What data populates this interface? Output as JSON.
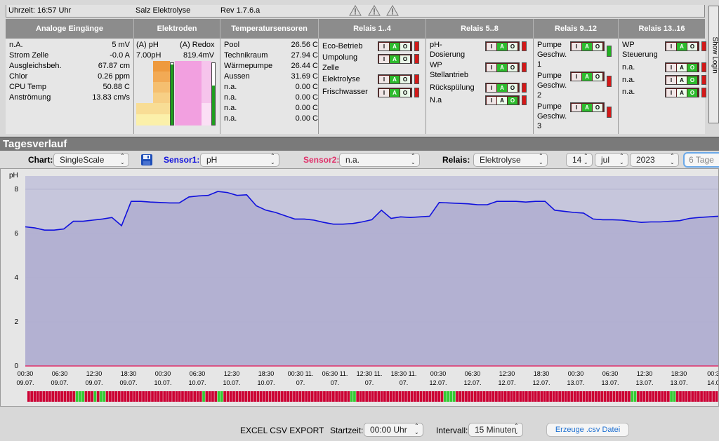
{
  "topbar": {
    "time": "Uhrzeit: 16:57 Uhr",
    "title": "Salz Elektrolyse",
    "rev": "Rev 1.7.6.a"
  },
  "header": {
    "analog": "Analoge Eingänge",
    "elektroden": "Elektroden",
    "temp": "Temperatursensoren",
    "r1": "Relais 1..4",
    "r2": "Relais 5..8",
    "r3": "Relais 9..12",
    "r4": "Relais 13..16"
  },
  "analog": [
    {
      "label": "n.A.",
      "value": "5 mV"
    },
    {
      "label": "Strom Zelle",
      "value": "-0.0 A"
    },
    {
      "label": "Ausgleichsbeh.",
      "value": "67.87 cm"
    },
    {
      "label": "Chlor",
      "value": "0.26 ppm"
    },
    {
      "label": "CPU Temp",
      "value": "50.88 C"
    },
    {
      "label": "Anströmung",
      "value": "13.83 cm/s"
    }
  ],
  "elektroden": {
    "ph_label": "(A) pH",
    "ph_value": "7.00pH",
    "redox_label": "(A) Redox",
    "redox_value": "819.4mV"
  },
  "temps": [
    {
      "label": "Pool",
      "value": "26.56 C"
    },
    {
      "label": "Technikraum",
      "value": "27.94 C"
    },
    {
      "label": "Wärmepumpe",
      "value": "26.44 C"
    },
    {
      "label": "Aussen",
      "value": "31.69 C"
    },
    {
      "label": "n.a.",
      "value": "0.00 C"
    },
    {
      "label": "n.a.",
      "value": "0.00 C"
    },
    {
      "label": "n.a.",
      "value": "0.00 C"
    },
    {
      "label": "n.a.",
      "value": "0.00 C"
    }
  ],
  "relays1": [
    "Eco-Betrieb",
    "Umpolung",
    "Zelle",
    "Elektrolyse",
    "Frischwasser"
  ],
  "relays2": [
    "pH-",
    "Dosierung",
    "WP",
    "Stellantrieb",
    "Rückspülung",
    "N.a"
  ],
  "relays3": [
    "Pumpe",
    "Geschw.",
    "1",
    "Pumpe",
    "Geschw.",
    "2",
    "Pumpe",
    "Geschw.",
    "3"
  ],
  "relays4": [
    "WP",
    "Steuerung",
    "n.a.",
    "n.a.",
    "n.a."
  ],
  "relay_btn": {
    "i": "I",
    "a": "A",
    "o": "O"
  },
  "login": "Show Login",
  "tagesverlauf": "Tagesverlauf",
  "controls": {
    "chart_label": "Chart:",
    "chart_value": "SingleScale",
    "sensor1_label": "Sensor1:",
    "sensor1_value": "pH",
    "sensor2_label": "Sensor2:",
    "sensor2_value": "n.a.",
    "relais_label": "Relais:",
    "relais_value": "Elektrolyse",
    "day": "14",
    "month": "jul",
    "year": "2023",
    "range": "6 Tage"
  },
  "colors": {
    "sensor1": "#1010dd",
    "sensor2": "#e0306a",
    "area": "#b0aed0",
    "on": "#33cc33",
    "off": "#cc0033"
  },
  "chart_data": {
    "type": "area",
    "ylabel": "pH",
    "ylim": [
      0,
      8.6
    ],
    "yticks": [
      "8",
      "6",
      "4",
      "2",
      "0"
    ],
    "yticks_values": [
      8,
      6,
      4,
      2,
      0
    ],
    "xticks": [
      [
        "00:30",
        "09.07."
      ],
      [
        "06:30",
        "09.07."
      ],
      [
        "12:30",
        "09.07."
      ],
      [
        "18:30",
        "09.07."
      ],
      [
        "00:30",
        "10.07."
      ],
      [
        "06:30",
        "10.07."
      ],
      [
        "12:30",
        "10.07."
      ],
      [
        "18:30",
        "10.07."
      ],
      [
        "00:30 11.",
        "07."
      ],
      [
        "06:30 11.",
        "07."
      ],
      [
        "12:30 11.",
        "07."
      ],
      [
        "18:30 11.",
        "07."
      ],
      [
        "00:30",
        "12.07."
      ],
      [
        "06:30",
        "12.07."
      ],
      [
        "12:30",
        "12.07."
      ],
      [
        "18:30",
        "12.07."
      ],
      [
        "00:30",
        "13.07."
      ],
      [
        "06:30",
        "13.07."
      ],
      [
        "12:30",
        "13.07."
      ],
      [
        "18:30",
        "13.07."
      ],
      [
        "00:3",
        "14.0"
      ]
    ],
    "series": [
      {
        "values": [
          6.3,
          6.25,
          6.15,
          6.15,
          6.2,
          6.55,
          6.55,
          6.6,
          6.65,
          6.72,
          6.35,
          7.45,
          7.45,
          7.42,
          7.4,
          7.38,
          7.38,
          7.65,
          7.7,
          7.72,
          7.9,
          7.85,
          7.72,
          7.75,
          7.25,
          7.05,
          6.95,
          6.8,
          6.65,
          6.65,
          6.6,
          6.5,
          6.42,
          6.42,
          6.45,
          6.52,
          6.62,
          7.05,
          6.68,
          6.75,
          6.72,
          6.75,
          6.78,
          7.4,
          7.38,
          7.36,
          7.34,
          7.3,
          7.3,
          7.45,
          7.45,
          7.45,
          7.42,
          7.45,
          7.45,
          7.05,
          7.0,
          6.95,
          6.92,
          6.65,
          6.62,
          6.62,
          6.6,
          6.55,
          6.5,
          6.52,
          6.52,
          6.55,
          6.58,
          6.68,
          6.72,
          6.75,
          6.78
        ]
      }
    ],
    "relay_strip": [
      0,
      0,
      0,
      0,
      0,
      0,
      0,
      0,
      0,
      0,
      0,
      0,
      0,
      0,
      0,
      0,
      1,
      1,
      1,
      0,
      0,
      0,
      1,
      0,
      1,
      1,
      0,
      0,
      0,
      0,
      0,
      0,
      0,
      0,
      0,
      0,
      0,
      0,
      0,
      0,
      0,
      0,
      0,
      0,
      0,
      0,
      0,
      0,
      0,
      0,
      0,
      0,
      0,
      0,
      0,
      0,
      0,
      0,
      1,
      0,
      0,
      0,
      0,
      1,
      1,
      0,
      0,
      0,
      0,
      0,
      0,
      0,
      0,
      0,
      0,
      0,
      0,
      0,
      0,
      0,
      0,
      0,
      0,
      0,
      0,
      0,
      0,
      0,
      0,
      0,
      0,
      0,
      0,
      0,
      0,
      0,
      0,
      0,
      0,
      0,
      0,
      0,
      0,
      0,
      0,
      0,
      0,
      1,
      1,
      0,
      0,
      0,
      0,
      0,
      0,
      0,
      0,
      0,
      0,
      0,
      0,
      0,
      0,
      0,
      0,
      0,
      0,
      0,
      0,
      0,
      0,
      0,
      0,
      0,
      0,
      0,
      0,
      0,
      1,
      1,
      1,
      1,
      0,
      0,
      0,
      0,
      0,
      0,
      0,
      0,
      0,
      0,
      0,
      0,
      0,
      0,
      0,
      0,
      0,
      0,
      0,
      0,
      0,
      0,
      0,
      0,
      0,
      0,
      0,
      0,
      0,
      0,
      0,
      0,
      0,
      0,
      0,
      0,
      0,
      0,
      0,
      0,
      0,
      0,
      0,
      0,
      0,
      0,
      0,
      0,
      0,
      0,
      0,
      0,
      0,
      0,
      0,
      0,
      0,
      0,
      1,
      1,
      0,
      0,
      0,
      0,
      0,
      0,
      0,
      0,
      0,
      0,
      0,
      1,
      1,
      0,
      0,
      0,
      0,
      0,
      0,
      0,
      0,
      0,
      0,
      0,
      0,
      0,
      0
    ]
  },
  "bottom": {
    "export": "EXCEL CSV EXPORT",
    "start_label": "Startzeit:",
    "start_value": "00:00 Uhr",
    "interval_label": "Intervall:",
    "interval_value": "15 Minuten",
    "create": "Erzeuge .csv Datei"
  }
}
